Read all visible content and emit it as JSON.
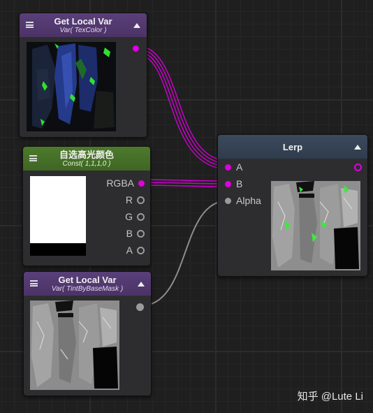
{
  "colors": {
    "magenta": "#e000e0",
    "grey_wire": "#8d8d8d"
  },
  "nodes": {
    "get_var_texcolor": {
      "title": "Get Local Var",
      "subtitle": "Var( TexColor )"
    },
    "const_color": {
      "title": "自选高光颜色",
      "subtitle": "Const( 1,1,1,0 )",
      "outputs": [
        "RGBA",
        "R",
        "G",
        "B",
        "A"
      ]
    },
    "get_var_mask": {
      "title": "Get Local Var",
      "subtitle": "Var( TintByBaseMask )"
    },
    "lerp": {
      "title": "Lerp",
      "inputs": [
        "A",
        "B",
        "Alpha"
      ]
    }
  },
  "watermark": "知乎 @Lute Li"
}
